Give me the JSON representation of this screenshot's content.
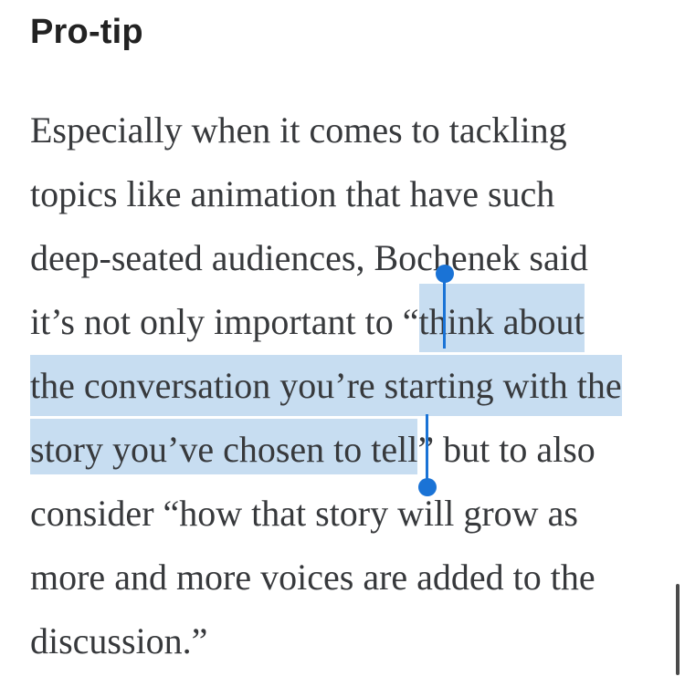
{
  "heading": "Pro-tip",
  "paragraph": {
    "line1": "Especially when it comes to tackling",
    "line2": "topics like animation that have such",
    "line3": "deep-seated audiences, Bochenek said",
    "line4_before": "it’s not only important to “",
    "line4_selected": "think about",
    "line5_selected": "the conversation you’re starting with the",
    "line6_selected": "story you’ve chosen to tell",
    "line6_after": "” but to also",
    "line7": "consider “how that story will grow as",
    "line8": "more and more voices are added to the",
    "line9": "discussion.”"
  },
  "colors": {
    "selection_highlight": "#c7ddf1",
    "selection_handle": "#1a73d6",
    "text": "#37393c",
    "heading": "#222222"
  },
  "icons": {
    "selection_start_handle": "text-selection-start-handle",
    "selection_end_handle": "text-selection-end-handle"
  }
}
